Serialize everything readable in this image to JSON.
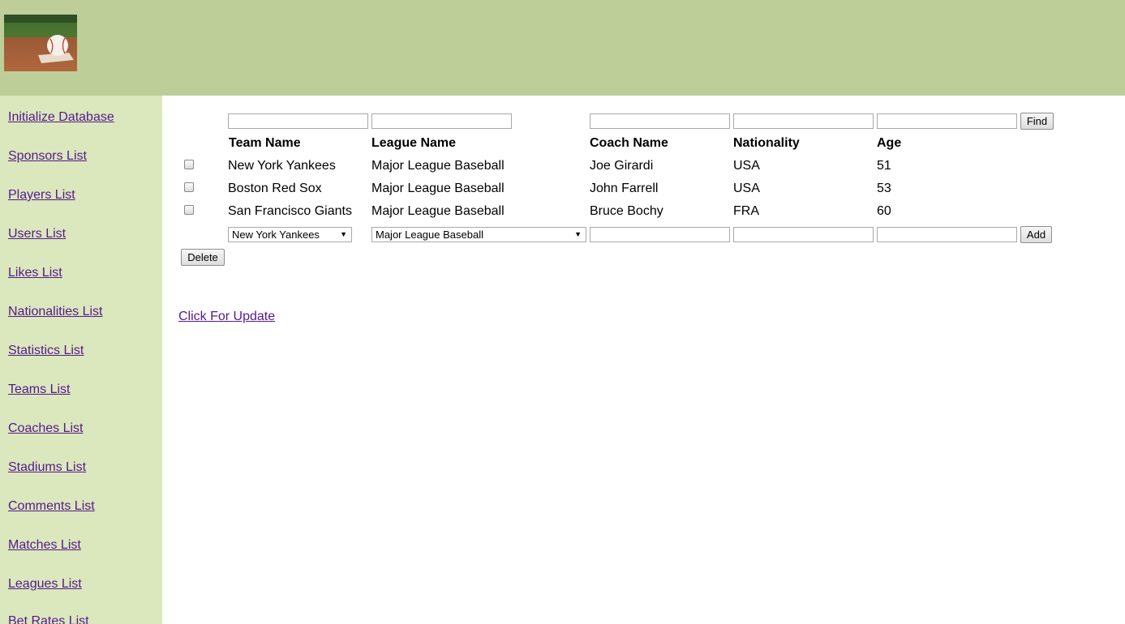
{
  "sidebar": {
    "items": [
      {
        "label": "Initialize Database"
      },
      {
        "label": "Sponsors List"
      },
      {
        "label": "Players List"
      },
      {
        "label": "Users List"
      },
      {
        "label": "Likes List"
      },
      {
        "label": "Nationalities List"
      },
      {
        "label": "Statistics List"
      },
      {
        "label": "Teams List"
      },
      {
        "label": "Coaches List"
      },
      {
        "label": "Stadiums List"
      },
      {
        "label": "Comments List"
      },
      {
        "label": "Matches List"
      },
      {
        "label": "Leagues List"
      },
      {
        "label": "Bet Rates List"
      }
    ]
  },
  "filters": {
    "team": "",
    "league": "",
    "coach": "",
    "nationality": "",
    "age": "",
    "find_label": "Find"
  },
  "table": {
    "headers": [
      "Team Name",
      "League Name",
      "Coach Name",
      "Nationality",
      "Age"
    ],
    "rows": [
      {
        "team": "New York Yankees",
        "league": "Major League Baseball",
        "coach": "Joe Girardi",
        "nationality": "USA",
        "age": "51"
      },
      {
        "team": "Boston Red Sox",
        "league": "Major League Baseball",
        "coach": "John Farrell",
        "nationality": "USA",
        "age": "53"
      },
      {
        "team": "San Francisco Giants",
        "league": "Major League Baseball",
        "coach": "Bruce Bochy",
        "nationality": "FRA",
        "age": "60"
      }
    ]
  },
  "add_row": {
    "team_selected": "New York Yankees",
    "league_selected": "Major League Baseball",
    "coach": "",
    "nationality": "",
    "age": "",
    "add_label": "Add"
  },
  "delete_label": "Delete",
  "update_link": "Click For Update"
}
